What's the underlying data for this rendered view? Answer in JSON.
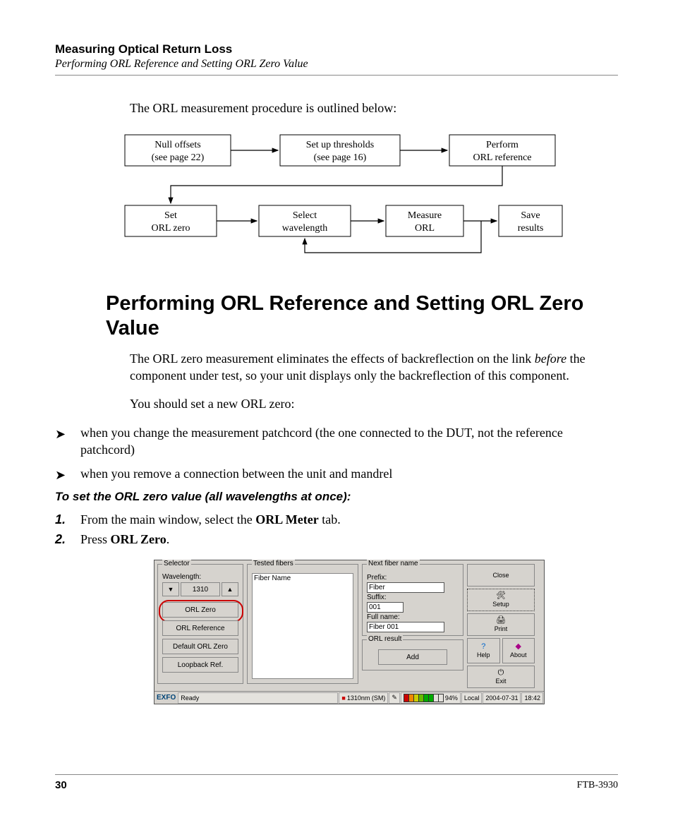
{
  "header": {
    "title": "Measuring Optical Return Loss",
    "subtitle": "Performing ORL Reference and Setting ORL Zero Value"
  },
  "intro": "The ORL measurement procedure is outlined below:",
  "flow": {
    "top": [
      {
        "l1": "Null offsets",
        "l2": "(see page 22)"
      },
      {
        "l1": "Set up thresholds",
        "l2": "(see page 16)"
      },
      {
        "l1": "Perform",
        "l2": "ORL reference"
      }
    ],
    "bottom": [
      {
        "l1": "Set",
        "l2": "ORL zero"
      },
      {
        "l1": "Select",
        "l2": "wavelength"
      },
      {
        "l1": "Measure",
        "l2": "ORL"
      },
      {
        "l1": "Save",
        "l2": "results"
      }
    ]
  },
  "section": {
    "heading": "Performing ORL Reference and Setting ORL Zero Value",
    "para1a": "The ORL zero measurement eliminates the effects of backreflection on the link ",
    "para1_em": "before",
    "para1b": " the component under test, so your unit displays only the backreflection of this component.",
    "para2": "You should set a new ORL zero:",
    "bullets": [
      "when you change the measurement patchcord (the one connected to the DUT, not the reference patchcord)",
      "when you remove a connection between the unit and mandrel"
    ],
    "subhead": "To set the ORL zero value (all wavelengths at once):",
    "steps": [
      {
        "num": "1.",
        "pre": "From the main window, select the ",
        "bold": "ORL Meter",
        "post": " tab."
      },
      {
        "num": "2.",
        "pre": "Press ",
        "bold": "ORL Zero",
        "post": "."
      }
    ]
  },
  "gui": {
    "selector": {
      "group": "Selector",
      "wavelength_label": "Wavelength:",
      "wavelength_value": "1310",
      "down": "▼",
      "up": "▲",
      "btn_orl_zero": "ORL Zero",
      "btn_orl_ref": "ORL Reference",
      "btn_def_zero": "Default ORL Zero",
      "btn_loopback": "Loopback Ref."
    },
    "tested": {
      "group": "Tested fibers",
      "col": "Fiber Name"
    },
    "nfn": {
      "group": "Next fiber name",
      "prefix_label": "Prefix:",
      "prefix_value": "Fiber",
      "suffix_label": "Suffix:",
      "suffix_value": "001",
      "fullname_label": "Full name:",
      "fullname_value": "Fiber 001"
    },
    "orl": {
      "group": "ORL result",
      "add": "Add"
    },
    "side": {
      "close": "Close",
      "setup": "Setup",
      "print": "Print",
      "help": "Help",
      "about": "About",
      "exit": "Exit"
    },
    "status": {
      "brand": "EXFO",
      "ready": "Ready",
      "wl": "1310nm (SM)",
      "pct": "94%",
      "local": "Local",
      "date": "2004-07-31",
      "time": "18:42"
    }
  },
  "footer": {
    "page": "30",
    "product": "FTB-3930"
  }
}
